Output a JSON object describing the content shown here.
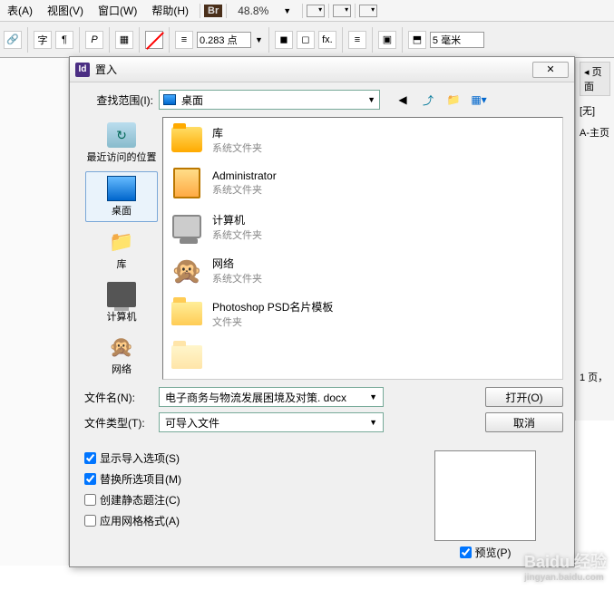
{
  "menu": {
    "table": "表(A)",
    "view": "视图(V)",
    "window": "窗口(W)",
    "help": "帮助(H)",
    "br": "Br",
    "zoom": "48.8%"
  },
  "toolbar": {
    "pt_value": "0.283 点",
    "mm_value": "5 毫米",
    "fx": "fx."
  },
  "right": {
    "pages": "页面",
    "none": "[无]",
    "master": "A-主页",
    "pagenum": "1 页，"
  },
  "dialog": {
    "title": "置入",
    "lookup_label": "查找范围(I):",
    "lookup_value": "桌面",
    "places": {
      "recent": "最近访问的位置",
      "desktop": "桌面",
      "library": "库",
      "computer": "计算机",
      "network": "网络"
    },
    "files": [
      {
        "name": "库",
        "sub": "系统文件夹"
      },
      {
        "name": "Administrator",
        "sub": "系统文件夹"
      },
      {
        "name": "计算机",
        "sub": "系统文件夹"
      },
      {
        "name": "网络",
        "sub": "系统文件夹"
      },
      {
        "name": "Photoshop PSD名片模板",
        "sub": "文件夹"
      }
    ],
    "filename_label": "文件名(N):",
    "filename_value": "电子商务与物流发展困境及对策. docx",
    "filetype_label": "文件类型(T):",
    "filetype_value": "可导入文件",
    "open_btn": "打开(O)",
    "cancel_btn": "取消",
    "chk_show_import": "显示导入选项(S)",
    "chk_replace": "替换所选项目(M)",
    "chk_static": "创建静态题注(C)",
    "chk_grid": "应用网格格式(A)",
    "preview": "预览(P)"
  },
  "watermark": {
    "main": "Baidu 经验",
    "sub": "jingyan.baidu.com"
  }
}
